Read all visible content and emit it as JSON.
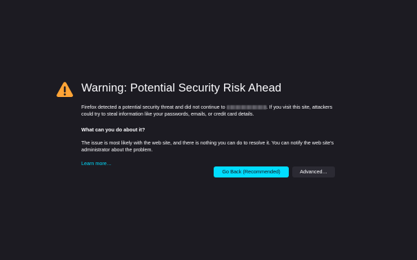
{
  "error_page": {
    "title": "Warning: Potential Security Risk Ahead",
    "intro_before": "Firefox detected a potential security threat and did not continue to ",
    "intro_after": ". If you visit this site, attackers could try to steal information like your passwords, emails, or credit card details.",
    "question": "What can you do about it?",
    "explanation": "The issue is most likely with the web site, and there is nothing you can do to resolve it. You can notify the web site's administrator about the problem.",
    "learn_more": "Learn more…"
  },
  "buttons": {
    "go_back": "Go Back (Recommended)",
    "advanced": "Advanced…"
  },
  "icons": {
    "warning": "warning-triangle-icon"
  },
  "colors": {
    "background": "#1c1b22",
    "text": "#fbfbfe",
    "accent": "#00ddff",
    "warning": "#ffa436",
    "secondary_button": "#2b2a33"
  }
}
